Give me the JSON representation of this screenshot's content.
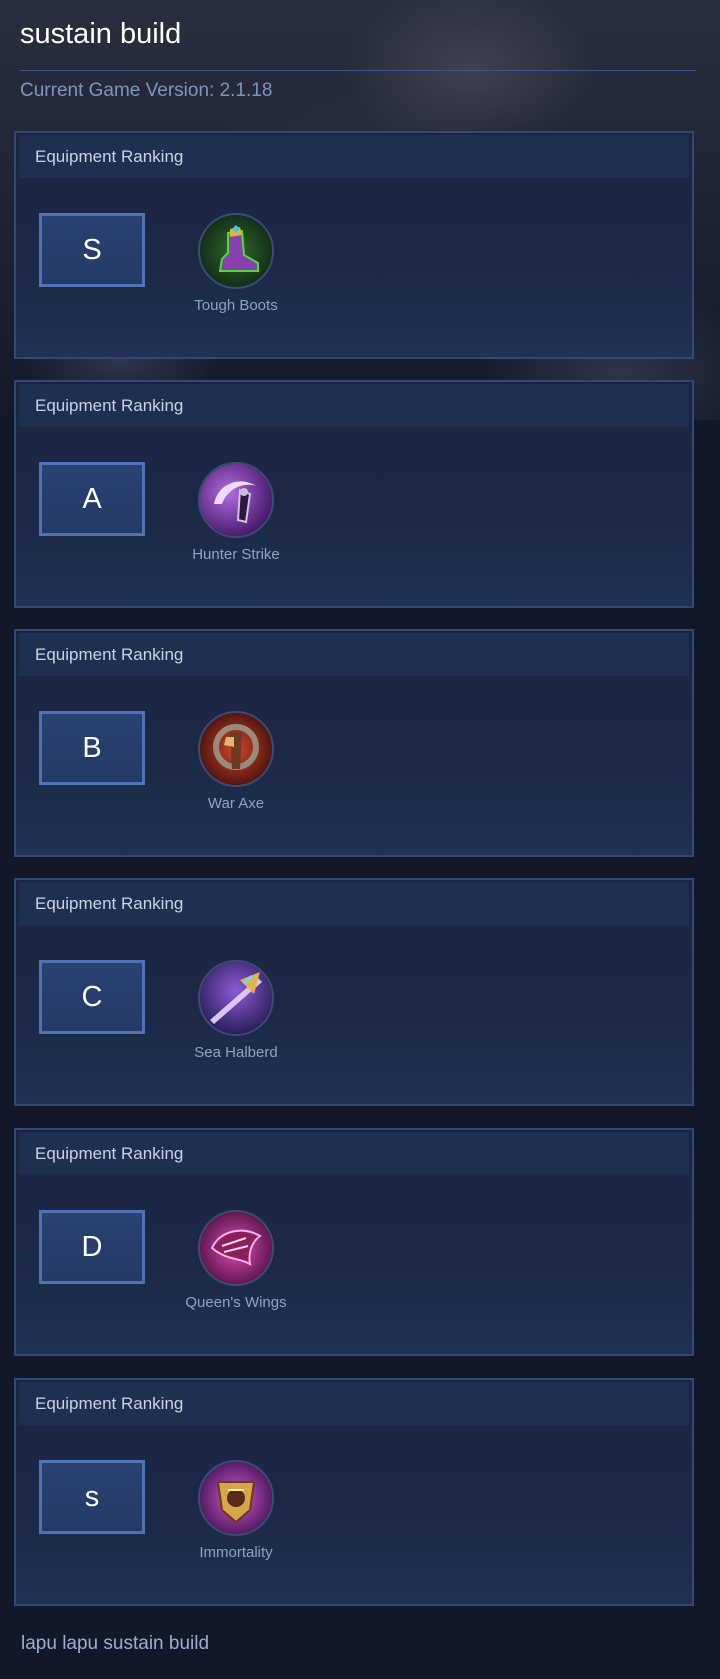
{
  "page": {
    "title": "sustain build",
    "version_text": "Current Game Version: 2.1.18",
    "footer_text": "lapu lapu sustain build"
  },
  "rankings": [
    {
      "header": "Equipment Ranking",
      "tier": "S",
      "item": {
        "name": "Tough Boots",
        "icon": "tough-boots-icon"
      }
    },
    {
      "header": "Equipment Ranking",
      "tier": "A",
      "item": {
        "name": "Hunter Strike",
        "icon": "hunter-strike-icon"
      }
    },
    {
      "header": "Equipment Ranking",
      "tier": "B",
      "item": {
        "name": "War Axe",
        "icon": "war-axe-icon"
      }
    },
    {
      "header": "Equipment Ranking",
      "tier": "C",
      "item": {
        "name": "Sea Halberd",
        "icon": "sea-halberd-icon"
      }
    },
    {
      "header": "Equipment Ranking",
      "tier": "D",
      "item": {
        "name": "Queen's Wings",
        "icon": "queens-wings-icon"
      }
    },
    {
      "header": "Equipment Ranking",
      "tier": "s",
      "item": {
        "name": "Immortality",
        "icon": "immortality-icon"
      }
    }
  ]
}
